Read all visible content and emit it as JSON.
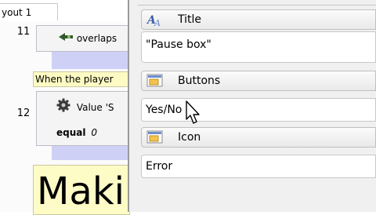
{
  "layout_tab": {
    "label": "yout 1"
  },
  "events": [
    {
      "number": "11",
      "condition_text": "overlaps",
      "icon": "sprite-overlap-icon"
    },
    {
      "number": "12",
      "condition_text": "Value 'S",
      "second_line_bold": "equal",
      "second_line_value": "0",
      "icon": "gear-icon"
    }
  ],
  "comment": {
    "text": "When the player"
  },
  "big_text": {
    "text": "Maki"
  },
  "properties": {
    "title": {
      "label": "Title",
      "icon": "text-icon",
      "value": "\"Pause box\""
    },
    "buttons": {
      "label": "Buttons",
      "icon": "dropdown-icon",
      "value": "Yes/No"
    },
    "icon": {
      "label": "Icon",
      "icon": "dropdown-icon",
      "value": "Error"
    }
  },
  "colors": {
    "purple_strip": "#cfd0f6",
    "comment_bg": "#fdfbc3",
    "panel_bg": "#f0f0f0"
  }
}
